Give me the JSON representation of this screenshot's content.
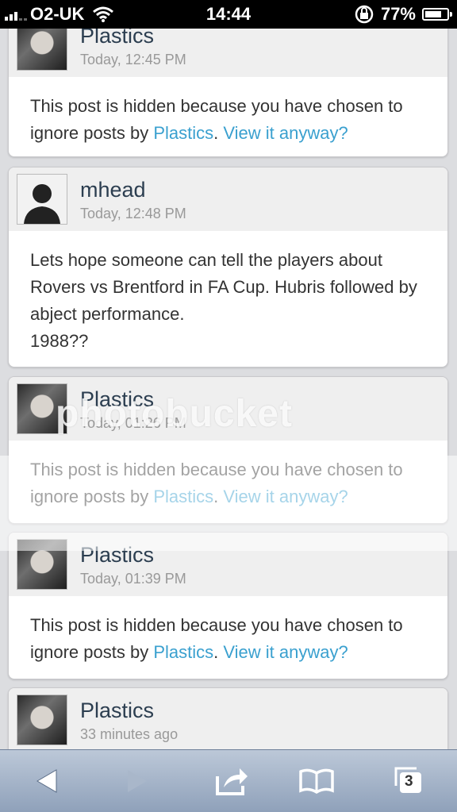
{
  "status_bar": {
    "carrier": "O2-UK",
    "time": "14:44",
    "battery_percent": "77%",
    "battery_level": 0.77
  },
  "posts": [
    {
      "author": "Plastics",
      "time": "Today, 12:45 PM",
      "hidden": true,
      "body_prefix": "This post is hidden because you have chosen to ignore posts by ",
      "author_link": "Plastics",
      "separator": ".",
      "view_link": "View it anyway?"
    },
    {
      "author": "mhead",
      "time": "Today, 12:48 PM",
      "hidden": false,
      "body_line1": "Lets hope someone can tell the players about Rovers vs Brentford in FA Cup. Hubris followed by abject performance.",
      "body_line2": "1988??"
    },
    {
      "author": "Plastics",
      "time": "Today, 01:26 PM",
      "hidden": true,
      "body_prefix": "This post is hidden because you have chosen to ignore posts by ",
      "author_link": "Plastics",
      "separator": ".",
      "view_link": "View it anyway?"
    },
    {
      "author": "Plastics",
      "time": "Today, 01:39 PM",
      "hidden": true,
      "body_prefix": "This post is hidden because you have chosen to ignore posts by ",
      "author_link": "Plastics",
      "separator": ".",
      "view_link": "View it anyway?"
    },
    {
      "author": "Plastics",
      "time": "33 minutes ago"
    }
  ],
  "watermark": "photobucket",
  "toolbar": {
    "tabs_count": "3",
    "icons": [
      "back-icon",
      "forward-icon",
      "share-icon",
      "bookmarks-icon",
      "tabs-icon"
    ]
  },
  "colors": {
    "link": "#3aa0cf",
    "author": "#2c3e50",
    "toolbar": "#9fb0c6"
  }
}
